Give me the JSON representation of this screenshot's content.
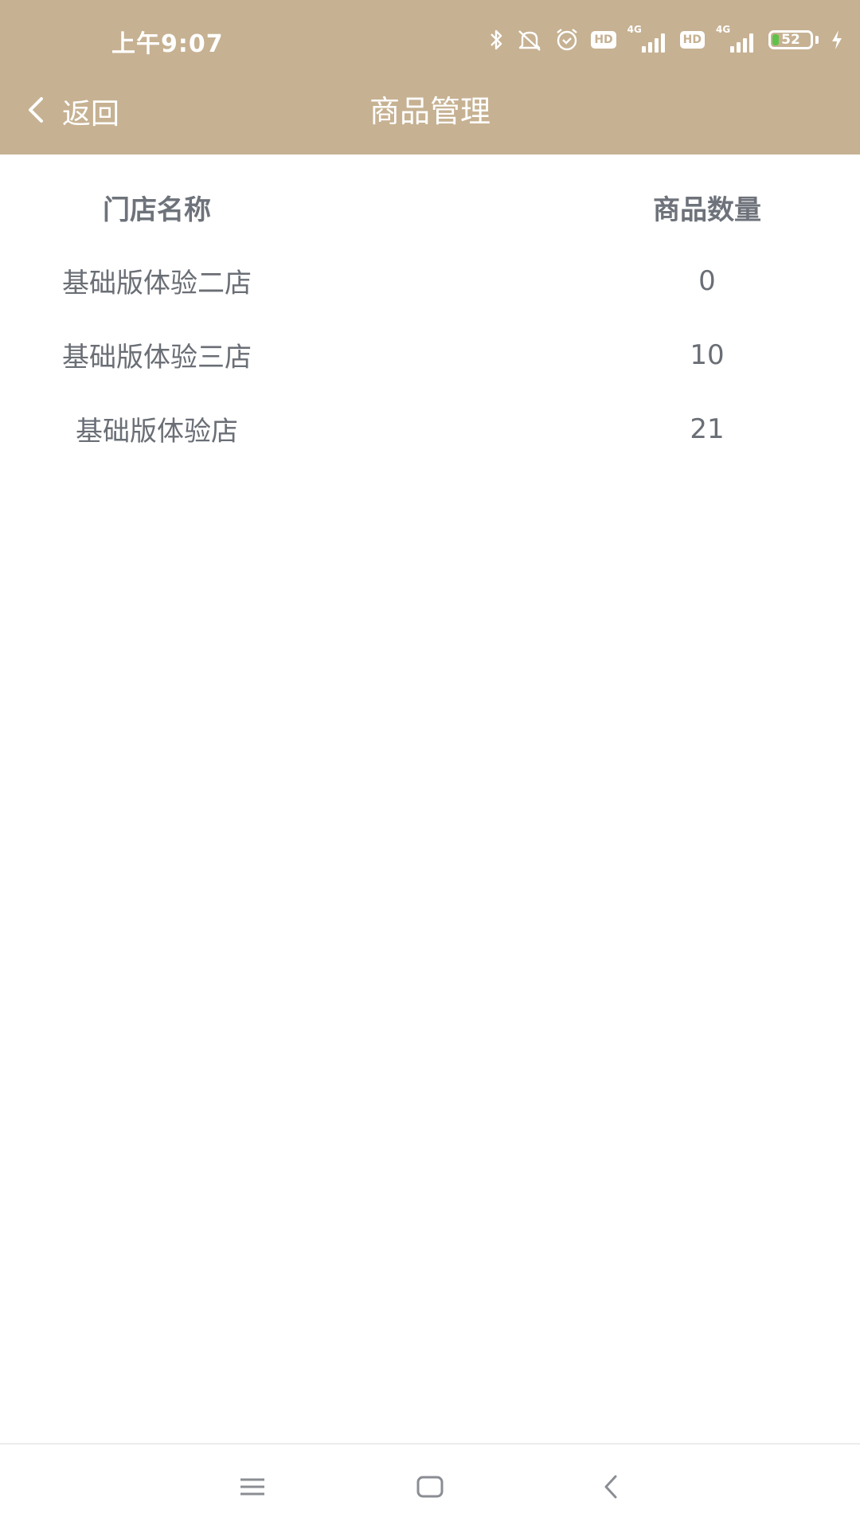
{
  "status_bar": {
    "time": "上午9:07",
    "hd_1": "HD",
    "net_1": "4G",
    "hd_2": "HD",
    "net_2": "4G",
    "battery_level": "52",
    "icons": [
      "bluetooth-icon",
      "mute-icon",
      "alarm-icon",
      "hd-badge",
      "signal-icon",
      "hd-badge",
      "signal-icon",
      "battery-icon",
      "charging-icon"
    ]
  },
  "header": {
    "back_label": "返回",
    "title": "商品管理"
  },
  "table": {
    "columns": [
      "门店名称",
      "商品数量"
    ],
    "rows": [
      {
        "name": "基础版体验二店",
        "count": "0"
      },
      {
        "name": "基础版体验三店",
        "count": "10"
      },
      {
        "name": "基础版体验店",
        "count": "21"
      }
    ]
  },
  "system_nav": {
    "icons": [
      "menu-icon",
      "home-icon",
      "back-icon"
    ]
  },
  "colors": {
    "header_bg": "#c6b192",
    "text": "#6a6e75",
    "battery_fill": "#5fc24a"
  }
}
